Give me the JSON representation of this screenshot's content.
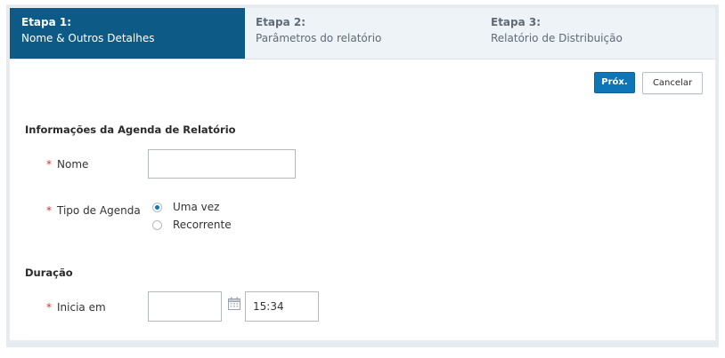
{
  "steps": [
    {
      "title": "Etapa 1:",
      "subtitle": "Nome & Outros Detalhes",
      "active": true
    },
    {
      "title": "Etapa 2:",
      "subtitle": "Parâmetros do relatório",
      "active": false
    },
    {
      "title": "Etapa 3:",
      "subtitle": "Relatório de Distribuição",
      "active": false
    }
  ],
  "actions": {
    "next_label": "Próx.",
    "cancel_label": "Cancelar"
  },
  "schedule_info": {
    "section_title": "Informações da Agenda de Relatório",
    "required_marker": "*",
    "name_label": "Nome",
    "name_value": "",
    "schedule_type_label": "Tipo de Agenda",
    "options": [
      {
        "label": "Uma vez",
        "selected": true
      },
      {
        "label": "Recorrente",
        "selected": false
      }
    ]
  },
  "duration": {
    "section_title": "Duração",
    "starts_label": "Inicia em",
    "date_value": "",
    "time_value": "15:34",
    "calendar_icon": "calendar-icon"
  },
  "colors": {
    "active_step": "#0e5a87",
    "primary_button": "#0e75b6",
    "required": "#d0312d"
  }
}
